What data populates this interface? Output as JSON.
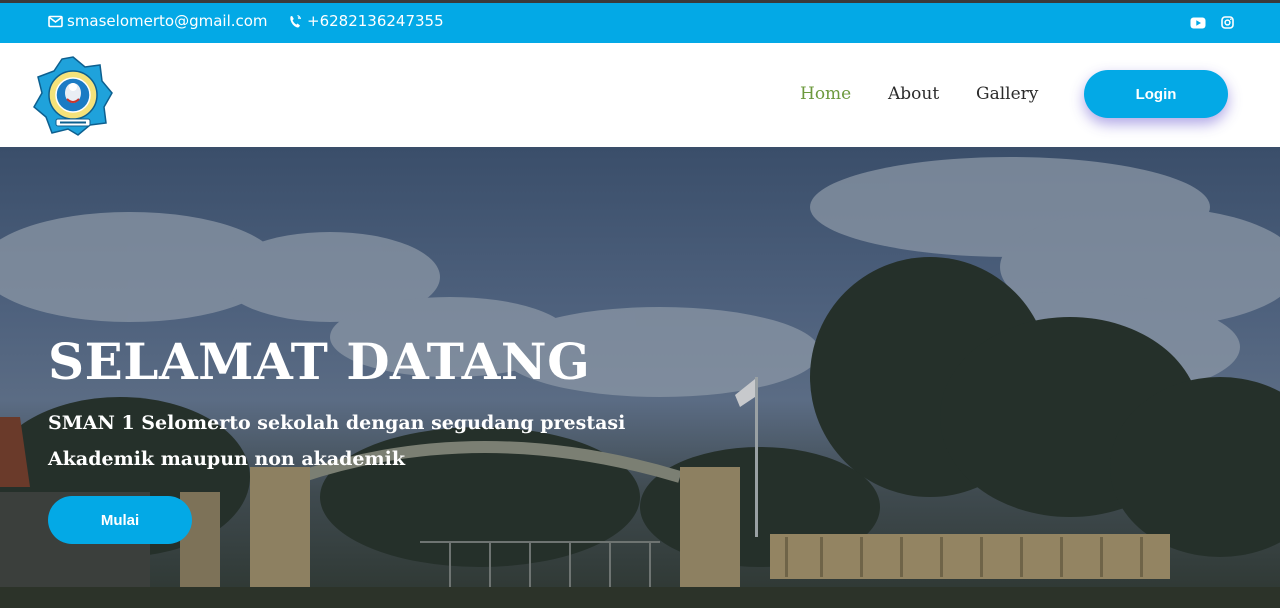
{
  "colors": {
    "accent": "#03a9e6",
    "nav_active": "#6d9a3e"
  },
  "topbar": {
    "email": "smaselomerto@gmail.com",
    "phone": "+6282136247355",
    "social_icons": [
      "youtube-icon",
      "instagram-icon"
    ]
  },
  "nav": {
    "items": [
      {
        "label": "Home",
        "active": true
      },
      {
        "label": "About",
        "active": false
      },
      {
        "label": "Gallery",
        "active": false
      }
    ],
    "login_label": "Login"
  },
  "hero": {
    "title": "SELAMAT DATANG",
    "line1": "SMAN 1 Selomerto sekolah dengan segudang prestasi",
    "line2": "Akademik maupun non akademik",
    "button_label": "Mulai"
  }
}
